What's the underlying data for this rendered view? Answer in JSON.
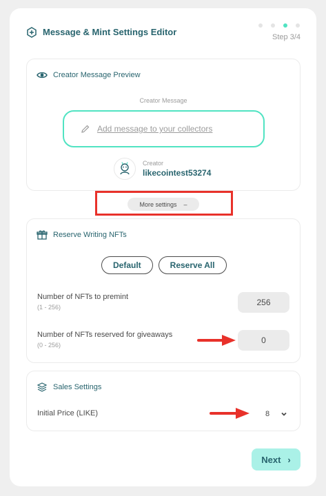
{
  "header": {
    "title": "Message & Mint Settings Editor",
    "step": "Step 3/4",
    "total_steps": 4,
    "current_step": 3
  },
  "preview": {
    "heading": "Creator Message Preview",
    "message_label": "Creator Message",
    "message_placeholder": "Add message to your collectors",
    "creator_role": "Creator",
    "creator_name": "likecointest53274"
  },
  "more_settings": {
    "label": "More settings",
    "toggle_symbol": "–"
  },
  "reserve": {
    "heading": "Reserve Writing NFTs",
    "default_label": "Default",
    "reserve_all_label": "Reserve All",
    "premint_label": "Number of NFTs to premint",
    "premint_range": "(1 - 256)",
    "premint_value": "256",
    "giveaway_label": "Number of NFTs reserved for giveaways",
    "giveaway_range": "(0 - 256)",
    "giveaway_value": "0"
  },
  "sales": {
    "heading": "Sales Settings",
    "price_label": "Initial Price (LIKE)",
    "price_value": "8"
  },
  "footer": {
    "next_label": "Next",
    "next_icon": "›"
  },
  "colors": {
    "accent": "#50e3c2",
    "brand_text": "#28646e",
    "annotation_red": "#e8312a",
    "next_bg": "#aaf1e7"
  }
}
